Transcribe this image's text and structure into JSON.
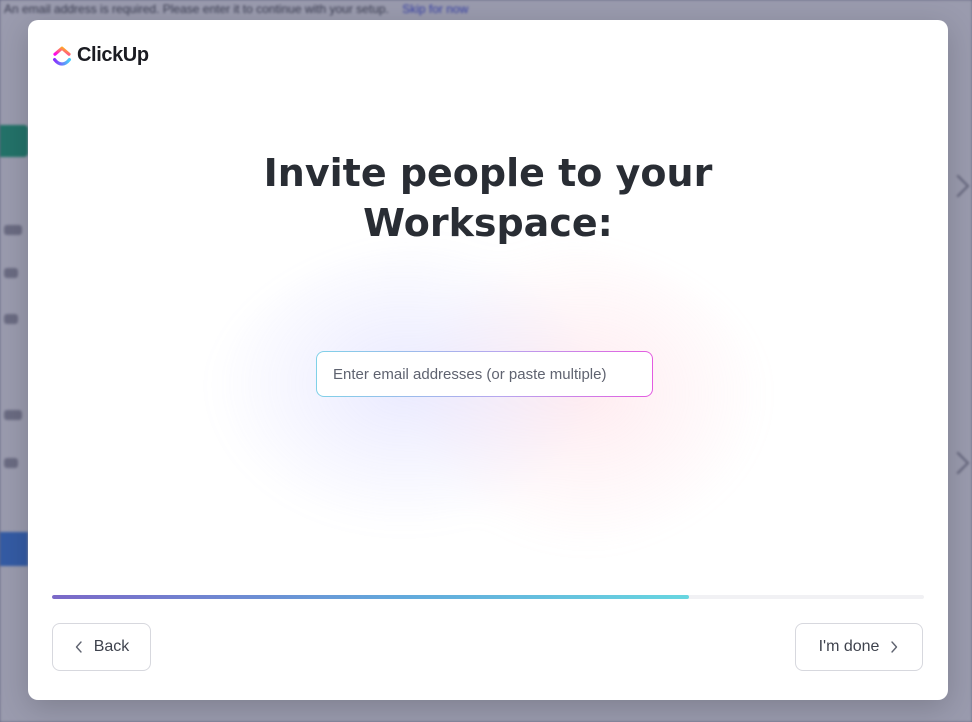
{
  "background": {
    "banner_text": "An email address is required. Please enter it to continue with your setup.",
    "banner_link": "Skip for now"
  },
  "brand": {
    "name": "ClickUp",
    "colors": {
      "purple": "#7b68ee",
      "pink": "#fd71af",
      "blue": "#49ccf9",
      "orange": "#ffc800"
    }
  },
  "heading": {
    "line1": "Invite people to your",
    "line2": "Workspace:"
  },
  "invite": {
    "placeholder": "Enter email addresses (or paste multiple)",
    "value": ""
  },
  "progress": {
    "percent": 73
  },
  "footer": {
    "back_label": "Back",
    "back_icon": "chevron-left-icon",
    "done_label": "I'm done",
    "done_icon": "chevron-right-icon"
  }
}
